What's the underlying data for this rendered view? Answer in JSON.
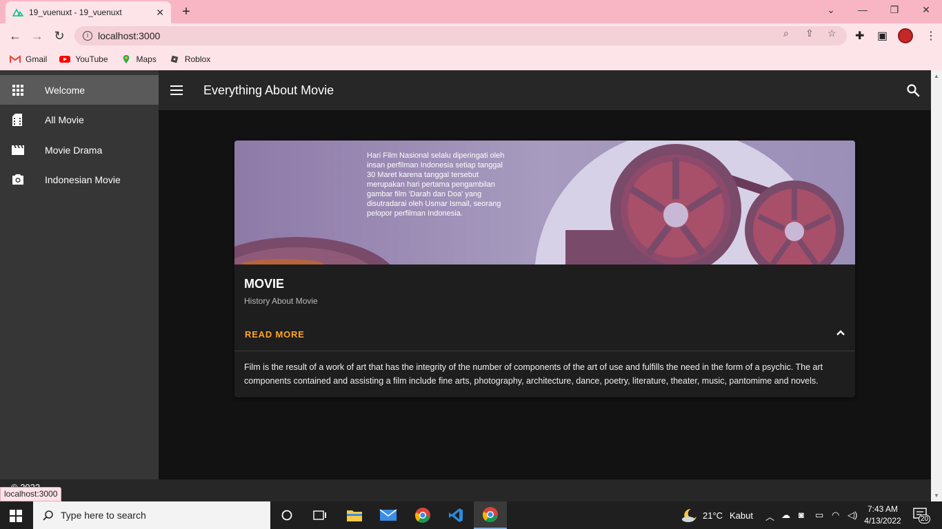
{
  "browser": {
    "tab_title": "19_vuenuxt - 19_vuenuxt",
    "url": "localhost:3000",
    "bookmarks": [
      {
        "label": "Gmail"
      },
      {
        "label": "YouTube"
      },
      {
        "label": "Maps"
      },
      {
        "label": "Roblox"
      }
    ],
    "status_url": "localhost:3000"
  },
  "drawer": {
    "items": [
      {
        "label": "Welcome",
        "icon": "apps-grid-icon",
        "active": true
      },
      {
        "label": "All Movie",
        "icon": "film-file-icon"
      },
      {
        "label": "Movie Drama",
        "icon": "clapperboard-icon"
      },
      {
        "label": "Indonesian Movie",
        "icon": "camera-icon"
      }
    ]
  },
  "appbar": {
    "title": "Everything About Movie"
  },
  "card": {
    "image_caption": "Hari Film Nasional selalu diperingati oleh insan perfilman Indonesia setiap tanggal 30 Maret karena tanggal tersebut merupakan hari pertama pengambilan gambar film 'Darah dan Doa' yang disutradarai oleh Usmar Ismail, seorang pelopor perfilman Indonesia.",
    "title": "MOVIE",
    "subtitle": "History About Movie",
    "action_label": "READ MORE",
    "expanded_text": "Film is the result of a work of art that has the integrity of the number of components of the art of use and fulfills the need in the form of a psychic. The art components contained and assisting a film include fine arts, photography, architecture, dance, poetry, literature, theater, music, pantomime and novels."
  },
  "footer": {
    "text": "© 2022"
  },
  "taskbar": {
    "search_placeholder": "Type here to search",
    "weather_temp": "21°C",
    "weather_desc": "Kabut",
    "time": "7:43 AM",
    "date": "4/13/2022",
    "notification_count": "20"
  },
  "colors": {
    "accent": "#ffa726",
    "drawer_bg": "#363636",
    "appbar_bg": "#272727",
    "card_bg": "#1e1e1e",
    "chrome_pink": "#f8b6c4"
  }
}
